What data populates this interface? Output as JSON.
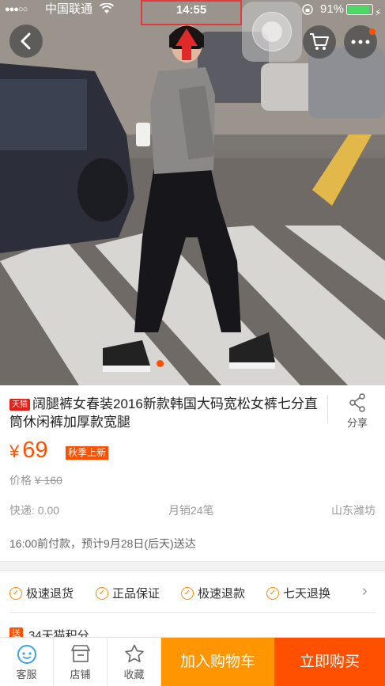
{
  "status_bar": {
    "signal": "●●●○○",
    "carrier": "中国联通",
    "time": "14:55",
    "battery_percent": "91%",
    "battery_level": 0.91
  },
  "hero": {
    "image_count_indicator_active": 1
  },
  "product": {
    "mall_badge": "天猫",
    "title": "阔腿裤女春装2016新款韩国大码宽松女裤七分直筒休闲裤加厚款宽腿",
    "share_label": "分享",
    "currency": "¥",
    "price": "69",
    "promo_tag": "秋季上新",
    "original_price_label": "价格",
    "original_price": "¥ 160",
    "shipping": "快递: 0.00",
    "monthly_sales": "月销24笔",
    "location": "山东潍坊",
    "delivery_note": "16:00前付款，预计9月28日(后天)送达"
  },
  "guarantees": [
    {
      "label": "极速退货"
    },
    {
      "label": "正品保证"
    },
    {
      "label": "极速退款"
    },
    {
      "label": "七天退换"
    }
  ],
  "points": {
    "badge": "送",
    "text": "34天猫积分"
  },
  "bottom_bar": {
    "customer_service": "客服",
    "shop": "店铺",
    "favorite": "收藏",
    "add_to_cart": "加入购物车",
    "buy_now": "立即购买"
  },
  "colors": {
    "accent": "#ff5000",
    "add_cart": "#ff9500",
    "check": "#ff8a00",
    "tmall": "#e3211b"
  },
  "icons": {
    "back": "chevron-left-icon",
    "cart": "shopping-cart-icon",
    "more": "more-dots-icon",
    "share": "share-icon",
    "service": "customer-service-icon",
    "shop": "shop-icon",
    "favorite": "star-icon"
  }
}
